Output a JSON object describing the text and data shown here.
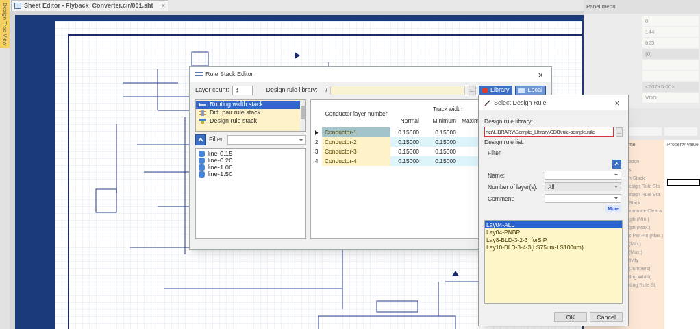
{
  "side_tab": {
    "label": "Design Tree View"
  },
  "editor_tab": {
    "title": "Sheet Editor - Flyback_Converter.cir/001.sht",
    "close": "×"
  },
  "panel": {
    "title": "Panel menu",
    "fields": [
      {
        "kind": "text",
        "value": "0"
      },
      {
        "kind": "text",
        "value": "144"
      },
      {
        "kind": "text",
        "value": "625"
      },
      {
        "kind": "grey",
        "value": "(0)"
      },
      {
        "kind": "blank"
      },
      {
        "kind": "blank"
      },
      {
        "kind": "grey",
        "value": "<207+5.00>"
      },
      {
        "kind": "text",
        "value": "VDD"
      }
    ]
  },
  "properties": {
    "columns": [
      "me",
      "Property Value"
    ],
    "rows": [
      "ation",
      "s",
      "h Stack",
      "esign Rule Sta",
      "esign Rule Sta",
      "Stack",
      "earance Cleara",
      "gth (Min.)",
      "gth (Max.)",
      "s Per Pin (Max.)",
      "(Min.)",
      "(Max.)",
      "tivity",
      "(Jumpers)",
      "ting Width)",
      "ding Rule St"
    ]
  },
  "rule_stack_editor": {
    "title": "Rule Stack Editor",
    "close": "×",
    "layer_count_label": "Layer count:",
    "layer_count": "4",
    "library_label": "Design rule library:",
    "library_prefix": "/",
    "browse": "...",
    "library_button": "Library",
    "local_button": "Local",
    "stacks": [
      {
        "label": "Routing width stack",
        "kind": "routing",
        "selected": true
      },
      {
        "label": "Diff. pair rule stack",
        "kind": "diff",
        "selected": false
      },
      {
        "label": "Design rule stack",
        "kind": "design",
        "selected": false
      }
    ],
    "filter_label": "Filter:",
    "lines": [
      "line-0.15",
      "line-0.20",
      "line-1.00",
      "line-1.50"
    ],
    "table": {
      "columns": [
        "Conductor layer number",
        "Track width",
        "Normal",
        "Minimum",
        "Maxim"
      ],
      "rows": [
        {
          "name": "Conductor-1",
          "normal": "0.15000",
          "minimum": "0.15000",
          "selected": true
        },
        {
          "index": "2",
          "name": "Conductor-2",
          "normal": "0.15000",
          "minimum": "0.15000",
          "selected": false
        },
        {
          "index": "3",
          "name": "Conductor-3",
          "normal": "0.15000",
          "minimum": "0.15000",
          "selected": false
        },
        {
          "index": "4",
          "name": "Conductor-4",
          "normal": "0.15000",
          "minimum": "0.15000",
          "selected": false
        }
      ]
    }
  },
  "select_design_rule": {
    "title": "Select Design Rule",
    "close": "×",
    "library_label": "Design rule library:",
    "library_value": "rter\\LIBRARY\\Sample_Library\\CDB\\rule-sample.rule",
    "browse": "...",
    "list_label": "Design rule list:",
    "filter_label": "Filter",
    "name_label": "Name:",
    "layers_label": "Number of layer(s):",
    "layers_value": "All",
    "comment_label": "Comment:",
    "more": "More",
    "rules": [
      {
        "label": "Lay04-ALL",
        "selected": true
      },
      {
        "label": "Lay04-PNBP",
        "selected": false
      },
      {
        "label": "Lay8-BLD-3-2-3_forSiP",
        "selected": false
      },
      {
        "label": "Lay10-BLD-3-4-3(LS75um-LS100um)",
        "selected": false
      }
    ],
    "ok": "OK",
    "cancel": "Cancel"
  }
}
